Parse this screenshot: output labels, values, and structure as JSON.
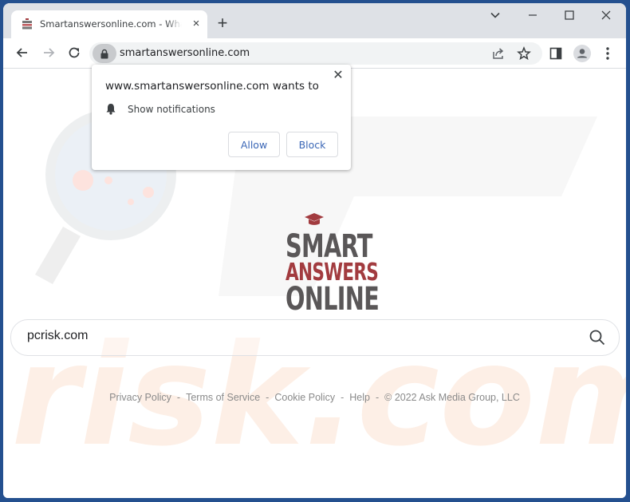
{
  "browser": {
    "tab": {
      "title": "Smartanswersonline.com - What",
      "favicon": "smart-answers-favicon",
      "close_icon": "×"
    },
    "new_tab_icon": "+",
    "window_controls": {
      "tab_search": "⌄",
      "minimize": "—",
      "maximize": "☐",
      "close": "✕"
    },
    "toolbar": {
      "url": "smartanswersonline.com",
      "icons": [
        "back-icon",
        "forward-icon",
        "reload-icon",
        "lock-icon",
        "share-icon",
        "bookmark-star-icon",
        "side-panel-icon",
        "profile-icon",
        "menu-icon"
      ]
    }
  },
  "notification_popup": {
    "title": "www.smartanswersonline.com wants to",
    "permission": "Show notifications",
    "allow_label": "Allow",
    "block_label": "Block",
    "close_icon": "✕"
  },
  "page": {
    "logo": {
      "line1": "SMART",
      "line2": "ANSWERS",
      "line3": "ONLINE",
      "colors": {
        "dark": "#5a5758",
        "red": "#a23b3f"
      }
    },
    "search": {
      "value": "pcrisk.com",
      "placeholder": ""
    },
    "footer": {
      "links": [
        "Privacy Policy",
        "Terms of Service",
        "Cookie Policy",
        "Help"
      ],
      "separator": "-",
      "copyright": "© 2022 Ask Media Group, LLC"
    }
  },
  "watermark": {
    "text_top": "PC",
    "text_bottom": "risk.com"
  }
}
